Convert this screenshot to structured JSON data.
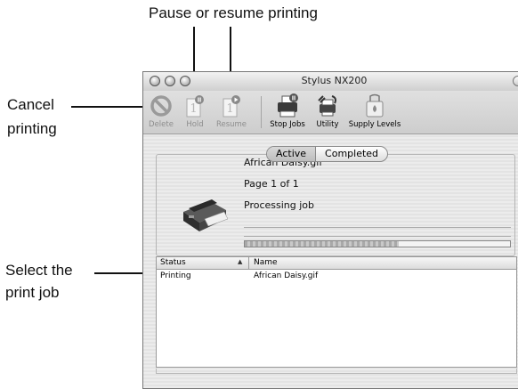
{
  "callouts": {
    "pause_resume": "Pause or resume printing",
    "cancel_line1": "Cancel",
    "cancel_line2": "printing",
    "select_line1": "Select the",
    "select_line2": "print job"
  },
  "window": {
    "title": "Stylus NX200"
  },
  "toolbar": {
    "delete_label": "Delete",
    "hold_label": "Hold",
    "resume_label": "Resume",
    "stop_jobs_label": "Stop Jobs",
    "utility_label": "Utility",
    "supply_levels_label": "Supply Levels"
  },
  "tabs": {
    "active": "Active",
    "completed": "Completed",
    "selected": "Active"
  },
  "job": {
    "filename": "African Daisy.gif",
    "page": "Page 1 of 1",
    "status": "Processing job",
    "progress": 0.58
  },
  "list": {
    "columns": [
      "Status",
      "Name"
    ],
    "rows": [
      {
        "status": "Printing",
        "name": "African Daisy.gif"
      }
    ]
  },
  "icons": {
    "delete": "delete-icon",
    "hold": "hold-icon",
    "resume": "resume-icon",
    "stop_jobs": "printer-icon",
    "utility": "utility-icon",
    "supply_levels": "ink-icon"
  }
}
